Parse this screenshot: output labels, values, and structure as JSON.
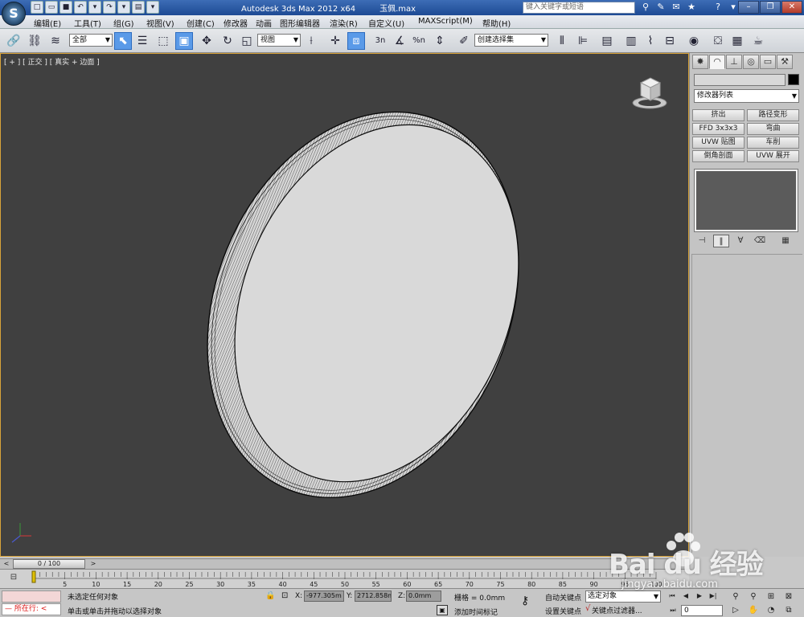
{
  "titlebar": {
    "app_logo": "S",
    "app_title": "Autodesk 3ds Max  2012 x64",
    "file_name": "玉佩.max",
    "search_placeholder": "键入关键字或短语"
  },
  "menubar": {
    "items": [
      "编辑(E)",
      "工具(T)",
      "组(G)",
      "视图(V)",
      "创建(C)",
      "修改器",
      "动画",
      "图形编辑器",
      "渲染(R)",
      "自定义(U)",
      "MAXScript(M)",
      "帮助(H)"
    ]
  },
  "toolbar": {
    "selection_filter": "全部",
    "reference_coord": "视图",
    "named_selection": "创建选择集",
    "percent_snap_label": "%n",
    "angle_snap_label": "3n"
  },
  "viewport": {
    "label": "[ + ] [ 正交 ] [ 真实 + 边面 ]"
  },
  "command_panel": {
    "modifier_list": "修改器列表",
    "modifier_buttons": [
      "挤出",
      "路径变形",
      "FFD 3x3x3",
      "弯曲",
      "UVW 贴图",
      "车削",
      "倒角剖面",
      "UVW 展开"
    ]
  },
  "timeline": {
    "position": "0 / 100",
    "ticks": [
      "0",
      "5",
      "10",
      "15",
      "20",
      "25",
      "30",
      "35",
      "40",
      "45",
      "50",
      "55",
      "60",
      "65",
      "70",
      "75",
      "80",
      "85",
      "90",
      "95",
      "100"
    ]
  },
  "status": {
    "maxscript_label": "所在行:",
    "selection": "未选定任何对象",
    "prompt": "单击或单击并拖动以选择对象",
    "x_label": "X:",
    "x_value": "-977.305m",
    "y_label": "Y:",
    "y_value": "2712.858m",
    "z_label": "Z:",
    "z_value": "0.0mm",
    "grid": "栅格 = 0.0mm",
    "add_time_tag": "添加时间标记",
    "auto_key": "自动关键点",
    "set_key": "设置关键点",
    "selected_set": "选定对象",
    "key_filters": "关键点过滤器...",
    "current_frame": "0"
  },
  "watermark": {
    "brand": "Bai du 经验",
    "url": "jingyan.baidu.com"
  },
  "colors": {
    "viewport_bg": "#404040",
    "viewport_border": "#d8a33a",
    "active_button": "#5a9ae8",
    "disc_face": "#d9d9d9"
  }
}
